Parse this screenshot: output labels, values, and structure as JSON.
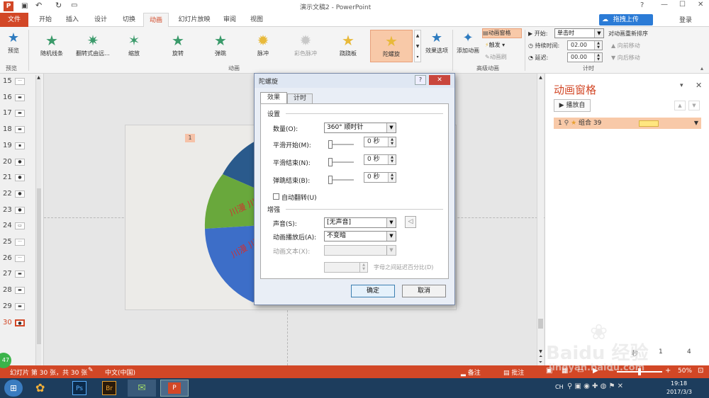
{
  "window": {
    "title": "演示文稿2 - PowerPoint",
    "help": "?",
    "signin": "登录"
  },
  "cloud_upload": "拖拽上传",
  "tabs": [
    "文件",
    "开始",
    "插入",
    "设计",
    "切换",
    "动画",
    "幻灯片放映",
    "审阅",
    "视图"
  ],
  "active_tab": "动画",
  "ribbon": {
    "preview": "预览",
    "preview_group": "预览",
    "animations": [
      "随机线条",
      "翻转式由远...",
      "缩放",
      "旋转",
      "弹跳",
      "脉冲",
      "彩色脉冲",
      "跷跷板",
      "陀螺旋"
    ],
    "animation_group": "动画",
    "effect_options": "效果选项",
    "add_animation": "添加动画",
    "animation_pane": "动画窗格",
    "trigger": "触发",
    "animation_painter": "动画刷",
    "advanced_group": "高级动画",
    "start_label": "开始:",
    "start_value": "单击时",
    "duration_label": "持续时间:",
    "duration_value": "02.00",
    "delay_label": "延迟:",
    "delay_value": "00.00",
    "reorder_label": "对动画重新排序",
    "move_earlier": "向前移动",
    "move_later": "向后移动",
    "timing_group": "计时"
  },
  "thumbnails": [
    "15",
    "16",
    "17",
    "18",
    "19",
    "20",
    "21",
    "22",
    "23",
    "24",
    "25",
    "26",
    "27",
    "28",
    "29",
    "30"
  ],
  "slide": {
    "anim_tag": "1",
    "wedge_text_1": "川漫 川",
    "wedge_text_2": "川漫 川"
  },
  "anim_pane": {
    "title": "动画窗格",
    "play_button": "播放自",
    "item_index": "1",
    "item_name": "组合 39"
  },
  "dialog": {
    "title": "陀螺旋",
    "tab_effect": "效果",
    "tab_timing": "计时",
    "section_settings": "设置",
    "amount_label": "数量(O):",
    "amount_value": "360° 顺时针",
    "smooth_start_label": "平滑开始(M):",
    "smooth_start_value": "0 秒",
    "smooth_end_label": "平滑结束(N):",
    "smooth_end_value": "0 秒",
    "bounce_end_label": "弹跳结束(B):",
    "bounce_end_value": "0 秒",
    "auto_reverse_label": "自动翻转(U)",
    "section_enhance": "增强",
    "sound_label": "声音(S):",
    "sound_value": "[无声音]",
    "after_anim_label": "动画播放后(A):",
    "after_anim_value": "不变暗",
    "anim_text_label": "动画文本(X):",
    "delay_between_label": "字母之间延迟百分比(D)",
    "ok": "确定",
    "cancel": "取消"
  },
  "statusbar": {
    "slide_info": "幻灯片 第 30 张，共 30 张",
    "language": "中文(中国)",
    "notes": "备注",
    "comments": "批注",
    "zoom": "50%",
    "badge": "47"
  },
  "anim_pane_footer": {
    "seconds_label": "秒",
    "tick_1": "1",
    "tick_4": "4"
  },
  "taskbar": {
    "ime": "CH",
    "time": "19:18",
    "date": "2017/3/3"
  },
  "watermark": {
    "brand": "Baidu 经验",
    "url": "jingyan.baidu.com"
  },
  "colors": {
    "accent": "#d24726",
    "selected_anim": "#f8c9a8",
    "dialog_bg": "#e9eef6"
  }
}
